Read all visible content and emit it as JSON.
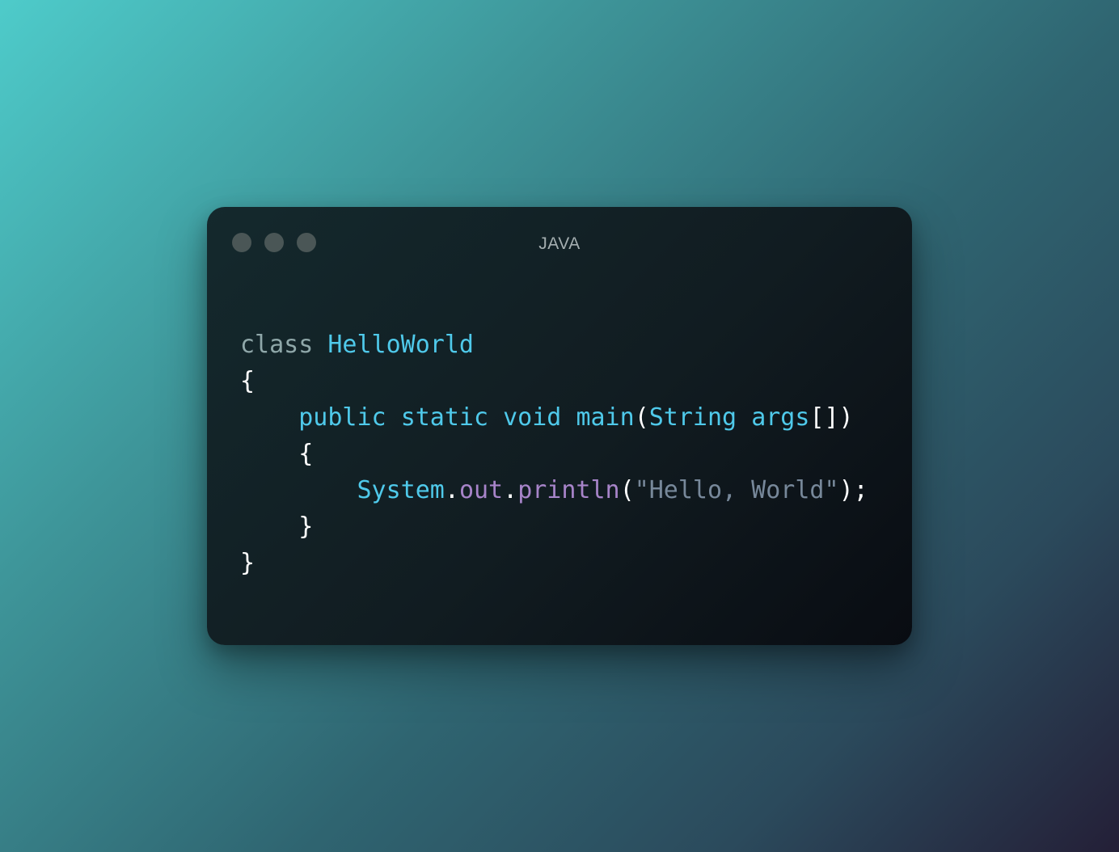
{
  "window": {
    "title": "JAVA"
  },
  "code": {
    "lines": [
      [
        {
          "t": "class",
          "c": "kw-class"
        },
        {
          "t": " ",
          "c": "punct"
        },
        {
          "t": "HelloWorld",
          "c": "ident"
        }
      ],
      [
        {
          "t": "{",
          "c": "punct"
        }
      ],
      [
        {
          "t": "    ",
          "c": "punct"
        },
        {
          "t": "public",
          "c": "ident"
        },
        {
          "t": " ",
          "c": "punct"
        },
        {
          "t": "static",
          "c": "ident"
        },
        {
          "t": " ",
          "c": "punct"
        },
        {
          "t": "void",
          "c": "ident"
        },
        {
          "t": " ",
          "c": "punct"
        },
        {
          "t": "main",
          "c": "ident"
        },
        {
          "t": "(",
          "c": "punct"
        },
        {
          "t": "String",
          "c": "ident"
        },
        {
          "t": " ",
          "c": "punct"
        },
        {
          "t": "args",
          "c": "ident"
        },
        {
          "t": "[])",
          "c": "punct"
        }
      ],
      [
        {
          "t": "    {",
          "c": "punct"
        }
      ],
      [
        {
          "t": "        ",
          "c": "punct"
        },
        {
          "t": "System",
          "c": "ident"
        },
        {
          "t": ".",
          "c": "punct"
        },
        {
          "t": "out",
          "c": "member"
        },
        {
          "t": ".",
          "c": "punct"
        },
        {
          "t": "println",
          "c": "member"
        },
        {
          "t": "(",
          "c": "punct"
        },
        {
          "t": "\"Hello, World\"",
          "c": "str"
        },
        {
          "t": ");",
          "c": "punct"
        }
      ],
      [
        {
          "t": "    }",
          "c": "punct"
        }
      ],
      [
        {
          "t": "}",
          "c": "punct"
        }
      ]
    ]
  },
  "colors": {
    "keyword_class": "#8fa7a9",
    "identifier": "#4fc9ea",
    "punctuation": "#ffffff",
    "member": "#a784c9",
    "string": "#77889a",
    "window_dot": "#4a5656"
  }
}
